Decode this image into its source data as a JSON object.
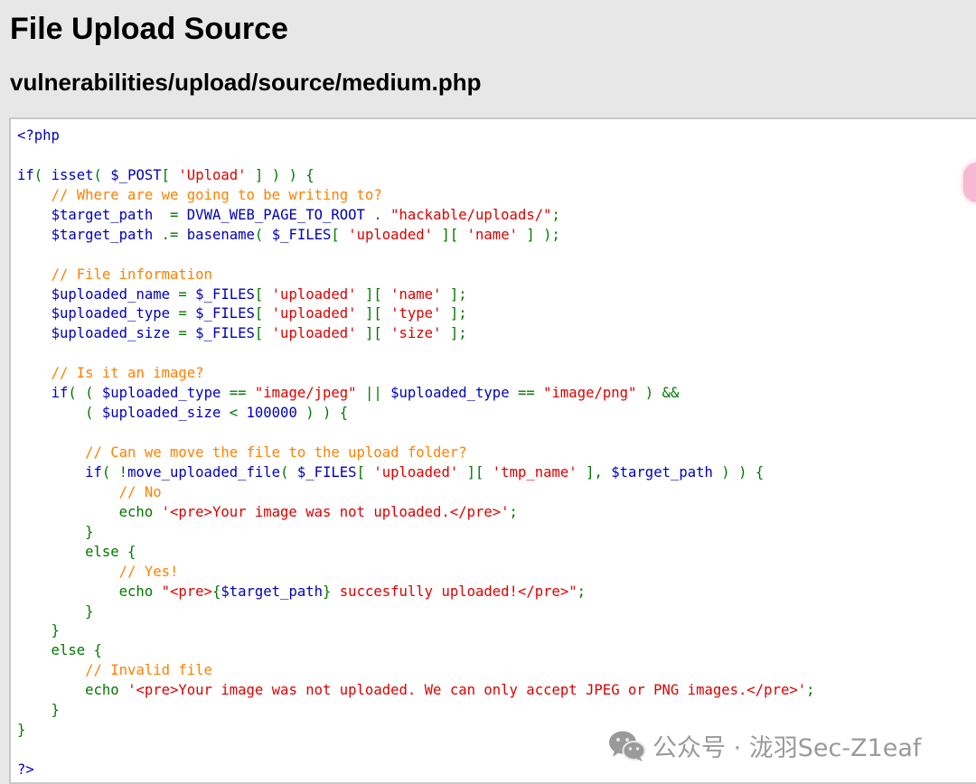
{
  "header": {
    "title": "File Upload Source",
    "file_path": "vulnerabilities/upload/source/medium.php"
  },
  "colors": {
    "default": "#0000bb",
    "keyword": "#007700",
    "string": "#dd0000",
    "comment": "#ff8000",
    "background": "#e7e7e7"
  },
  "code": {
    "lines": [
      [
        {
          "t": "default",
          "v": "<?php"
        }
      ],
      [],
      [
        {
          "t": "default",
          "v": "if"
        },
        {
          "t": "keyword",
          "v": "( "
        },
        {
          "t": "default",
          "v": "isset"
        },
        {
          "t": "keyword",
          "v": "( "
        },
        {
          "t": "default",
          "v": "$_POST"
        },
        {
          "t": "keyword",
          "v": "[ "
        },
        {
          "t": "string",
          "v": "'Upload'"
        },
        {
          "t": "keyword",
          "v": " ] ) ) {"
        }
      ],
      [
        {
          "t": "keyword",
          "v": "    "
        },
        {
          "t": "comment",
          "v": "// Where are we going to be writing to?"
        }
      ],
      [
        {
          "t": "keyword",
          "v": "    "
        },
        {
          "t": "default",
          "v": "$target_path"
        },
        {
          "t": "keyword",
          "v": "  = "
        },
        {
          "t": "default",
          "v": "DVWA_WEB_PAGE_TO_ROOT"
        },
        {
          "t": "keyword",
          "v": " . "
        },
        {
          "t": "string",
          "v": "\"hackable/uploads/\""
        },
        {
          "t": "keyword",
          "v": ";"
        }
      ],
      [
        {
          "t": "keyword",
          "v": "    "
        },
        {
          "t": "default",
          "v": "$target_path"
        },
        {
          "t": "keyword",
          "v": " .= "
        },
        {
          "t": "default",
          "v": "basename"
        },
        {
          "t": "keyword",
          "v": "( "
        },
        {
          "t": "default",
          "v": "$_FILES"
        },
        {
          "t": "keyword",
          "v": "[ "
        },
        {
          "t": "string",
          "v": "'uploaded'"
        },
        {
          "t": "keyword",
          "v": " ][ "
        },
        {
          "t": "string",
          "v": "'name'"
        },
        {
          "t": "keyword",
          "v": " ] );"
        }
      ],
      [],
      [
        {
          "t": "keyword",
          "v": "    "
        },
        {
          "t": "comment",
          "v": "// File information"
        }
      ],
      [
        {
          "t": "keyword",
          "v": "    "
        },
        {
          "t": "default",
          "v": "$uploaded_name"
        },
        {
          "t": "keyword",
          "v": " = "
        },
        {
          "t": "default",
          "v": "$_FILES"
        },
        {
          "t": "keyword",
          "v": "[ "
        },
        {
          "t": "string",
          "v": "'uploaded'"
        },
        {
          "t": "keyword",
          "v": " ][ "
        },
        {
          "t": "string",
          "v": "'name'"
        },
        {
          "t": "keyword",
          "v": " ];"
        }
      ],
      [
        {
          "t": "keyword",
          "v": "    "
        },
        {
          "t": "default",
          "v": "$uploaded_type"
        },
        {
          "t": "keyword",
          "v": " = "
        },
        {
          "t": "default",
          "v": "$_FILES"
        },
        {
          "t": "keyword",
          "v": "[ "
        },
        {
          "t": "string",
          "v": "'uploaded'"
        },
        {
          "t": "keyword",
          "v": " ][ "
        },
        {
          "t": "string",
          "v": "'type'"
        },
        {
          "t": "keyword",
          "v": " ];"
        }
      ],
      [
        {
          "t": "keyword",
          "v": "    "
        },
        {
          "t": "default",
          "v": "$uploaded_size"
        },
        {
          "t": "keyword",
          "v": " = "
        },
        {
          "t": "default",
          "v": "$_FILES"
        },
        {
          "t": "keyword",
          "v": "[ "
        },
        {
          "t": "string",
          "v": "'uploaded'"
        },
        {
          "t": "keyword",
          "v": " ][ "
        },
        {
          "t": "string",
          "v": "'size'"
        },
        {
          "t": "keyword",
          "v": " ];"
        }
      ],
      [],
      [
        {
          "t": "keyword",
          "v": "    "
        },
        {
          "t": "comment",
          "v": "// Is it an image?"
        }
      ],
      [
        {
          "t": "keyword",
          "v": "    "
        },
        {
          "t": "default",
          "v": "if"
        },
        {
          "t": "keyword",
          "v": "( ( "
        },
        {
          "t": "default",
          "v": "$uploaded_type"
        },
        {
          "t": "keyword",
          "v": " == "
        },
        {
          "t": "string",
          "v": "\"image/jpeg\""
        },
        {
          "t": "keyword",
          "v": " || "
        },
        {
          "t": "default",
          "v": "$uploaded_type"
        },
        {
          "t": "keyword",
          "v": " == "
        },
        {
          "t": "string",
          "v": "\"image/png\""
        },
        {
          "t": "keyword",
          "v": " ) &&"
        }
      ],
      [
        {
          "t": "keyword",
          "v": "        ( "
        },
        {
          "t": "default",
          "v": "$uploaded_size"
        },
        {
          "t": "keyword",
          "v": " < "
        },
        {
          "t": "default",
          "v": "100000"
        },
        {
          "t": "keyword",
          "v": " ) ) {"
        }
      ],
      [],
      [
        {
          "t": "keyword",
          "v": "        "
        },
        {
          "t": "comment",
          "v": "// Can we move the file to the upload folder?"
        }
      ],
      [
        {
          "t": "keyword",
          "v": "        "
        },
        {
          "t": "default",
          "v": "if"
        },
        {
          "t": "keyword",
          "v": "( !"
        },
        {
          "t": "default",
          "v": "move_uploaded_file"
        },
        {
          "t": "keyword",
          "v": "( "
        },
        {
          "t": "default",
          "v": "$_FILES"
        },
        {
          "t": "keyword",
          "v": "[ "
        },
        {
          "t": "string",
          "v": "'uploaded'"
        },
        {
          "t": "keyword",
          "v": " ][ "
        },
        {
          "t": "string",
          "v": "'tmp_name'"
        },
        {
          "t": "keyword",
          "v": " ], "
        },
        {
          "t": "default",
          "v": "$target_path"
        },
        {
          "t": "keyword",
          "v": " ) ) {"
        }
      ],
      [
        {
          "t": "keyword",
          "v": "            "
        },
        {
          "t": "comment",
          "v": "// No"
        }
      ],
      [
        {
          "t": "keyword",
          "v": "            echo "
        },
        {
          "t": "string",
          "v": "'<pre>Your image was not uploaded.</pre>'"
        },
        {
          "t": "keyword",
          "v": ";"
        }
      ],
      [
        {
          "t": "keyword",
          "v": "        }"
        }
      ],
      [
        {
          "t": "keyword",
          "v": "        else {"
        }
      ],
      [
        {
          "t": "keyword",
          "v": "            "
        },
        {
          "t": "comment",
          "v": "// Yes!"
        }
      ],
      [
        {
          "t": "keyword",
          "v": "            echo "
        },
        {
          "t": "string",
          "v": "\"<pre>"
        },
        {
          "t": "keyword",
          "v": "{"
        },
        {
          "t": "default",
          "v": "$target_path"
        },
        {
          "t": "keyword",
          "v": "}"
        },
        {
          "t": "string",
          "v": " succesfully uploaded!</pre>\""
        },
        {
          "t": "keyword",
          "v": ";"
        }
      ],
      [
        {
          "t": "keyword",
          "v": "        }"
        }
      ],
      [
        {
          "t": "keyword",
          "v": "    }"
        }
      ],
      [
        {
          "t": "keyword",
          "v": "    else {"
        }
      ],
      [
        {
          "t": "keyword",
          "v": "        "
        },
        {
          "t": "comment",
          "v": "// Invalid file"
        }
      ],
      [
        {
          "t": "keyword",
          "v": "        echo "
        },
        {
          "t": "string",
          "v": "'<pre>Your image was not uploaded. We can only accept JPEG or PNG images.</pre>'"
        },
        {
          "t": "keyword",
          "v": ";"
        }
      ],
      [
        {
          "t": "keyword",
          "v": "    }"
        }
      ],
      [
        {
          "t": "keyword",
          "v": "}"
        }
      ],
      [],
      [
        {
          "t": "default",
          "v": "?>"
        }
      ]
    ]
  },
  "watermark": {
    "icon": "wechat-icon",
    "text": "公众号 · 泷羽Sec-Z1eaf"
  }
}
